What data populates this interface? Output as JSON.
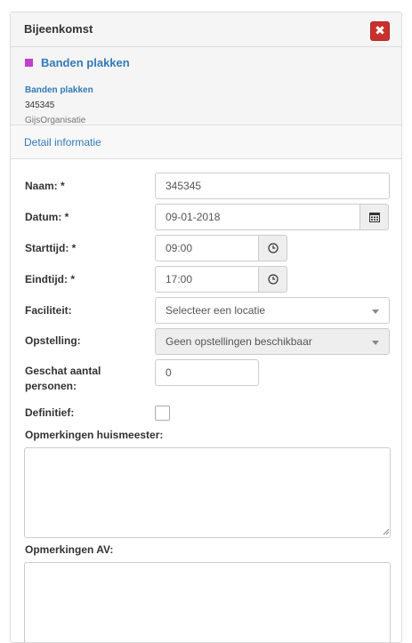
{
  "dialog": {
    "title": "Bijeenkomst",
    "close_label": "✖"
  },
  "event": {
    "color": "#c13fc9",
    "title": "Banden plakken",
    "subtitle": "Banden plakken",
    "number": "345345",
    "organisation": "GijsOrganisatie"
  },
  "section": {
    "tab_label": "Detail informatie"
  },
  "form": {
    "naam": {
      "label": "Naam: *",
      "value": "345345"
    },
    "datum": {
      "label": "Datum: *",
      "value": "09-01-2018",
      "icon": "calendar-icon"
    },
    "starttijd": {
      "label": "Starttijd: *",
      "value": "09:00",
      "icon": "clock-icon"
    },
    "eindtijd": {
      "label": "Eindtijd: *",
      "value": "17:00",
      "icon": "clock-icon"
    },
    "faciliteit": {
      "label": "Faciliteit:",
      "value": "Selecteer een locatie"
    },
    "opstelling": {
      "label": "Opstelling:",
      "value": "Geen opstellingen beschikbaar"
    },
    "aantal": {
      "label_line1": "Geschat aantal",
      "label_line2": "personen:",
      "value": "0"
    },
    "definitief": {
      "label": "Definitief:",
      "checked": false
    },
    "opmerkingen_huismeester": {
      "label": "Opmerkingen huismeester:",
      "value": ""
    },
    "opmerkingen_av": {
      "label": "Opmerkingen AV:",
      "value": ""
    }
  }
}
